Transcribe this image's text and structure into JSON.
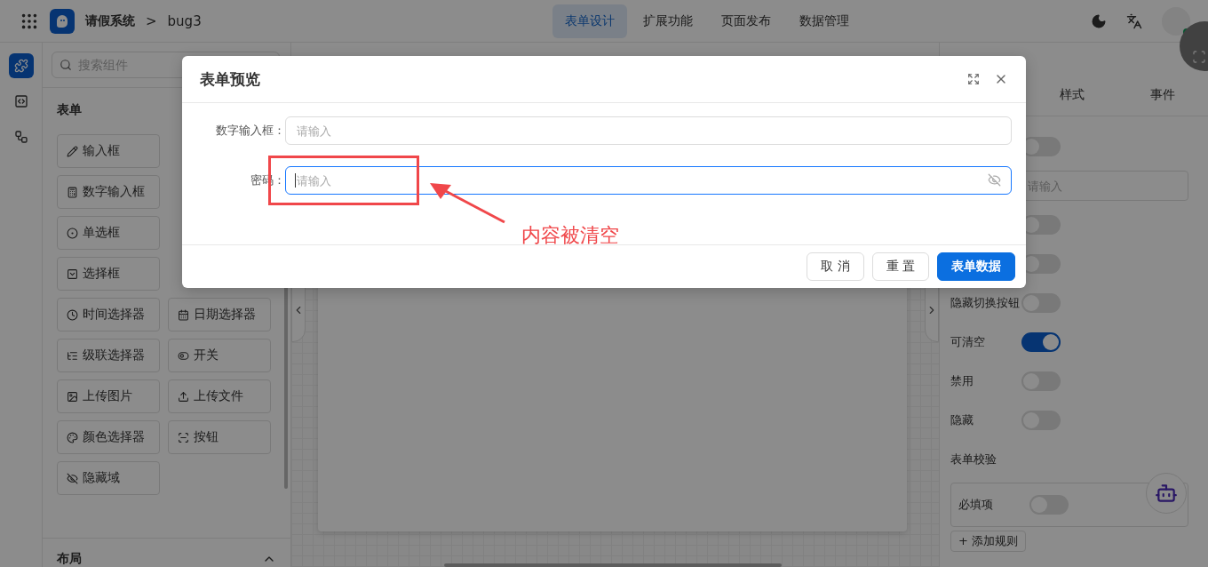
{
  "header": {
    "app_name": "请假系统",
    "separator": ">",
    "page": "bug3",
    "nav": [
      {
        "label": "表单设计",
        "selected": true
      },
      {
        "label": "扩展功能",
        "selected": false
      },
      {
        "label": "页面发布",
        "selected": false
      },
      {
        "label": "数据管理",
        "selected": false
      }
    ]
  },
  "rail": [
    {
      "selected": true
    },
    {
      "selected": false
    },
    {
      "selected": false
    }
  ],
  "palette": {
    "search_placeholder": "搜索组件",
    "section": "表单",
    "rows": [
      {
        "left": "输入框"
      },
      {
        "left": "数字输入框"
      },
      {
        "left": "单选框"
      },
      {
        "left": "选择框"
      },
      {
        "left": "时间选择器",
        "right": "日期选择器"
      },
      {
        "left": "级联选择器",
        "right": "开关"
      },
      {
        "left": "上传图片",
        "right": "上传文件"
      },
      {
        "left": "颜色选择器",
        "right": "按钮"
      },
      {
        "left": "隐藏域"
      }
    ],
    "layout_section": "布局"
  },
  "properties": {
    "tabs": [
      {
        "label": "样式",
        "selected": false
      },
      {
        "label": "事件",
        "selected": false
      }
    ],
    "rows": [
      {
        "kind": "toggle",
        "on": false
      },
      {
        "kind": "input",
        "placeholder": "请输入"
      },
      {
        "kind": "toggle",
        "on": false
      },
      {
        "kind": "toggle",
        "on": false
      },
      {
        "kind": "toggle",
        "label": "隐藏切换按钮",
        "on": false
      },
      {
        "kind": "toggle",
        "label": "可清空",
        "on": true
      },
      {
        "kind": "toggle",
        "label": "禁用",
        "on": false
      },
      {
        "kind": "toggle",
        "label": "隐藏",
        "on": false
      },
      {
        "kind": "heading",
        "label": "表单校验"
      },
      {
        "kind": "rule",
        "label": "必填项",
        "on": false
      },
      {
        "kind": "add",
        "label": "+ 添加规则"
      }
    ]
  },
  "dialog": {
    "title": "表单预览",
    "fields": [
      {
        "label": "数字输入框：",
        "placeholder": "请输入",
        "focused": false,
        "kind": "number"
      },
      {
        "label": "密码：",
        "placeholder": "请输入",
        "focused": true,
        "kind": "password"
      }
    ],
    "buttons": [
      {
        "label": "取 消",
        "primary": false
      },
      {
        "label": "重 置",
        "primary": false
      },
      {
        "label": "表单数据",
        "primary": true
      }
    ]
  },
  "annotation": {
    "text": "内容被清空"
  }
}
